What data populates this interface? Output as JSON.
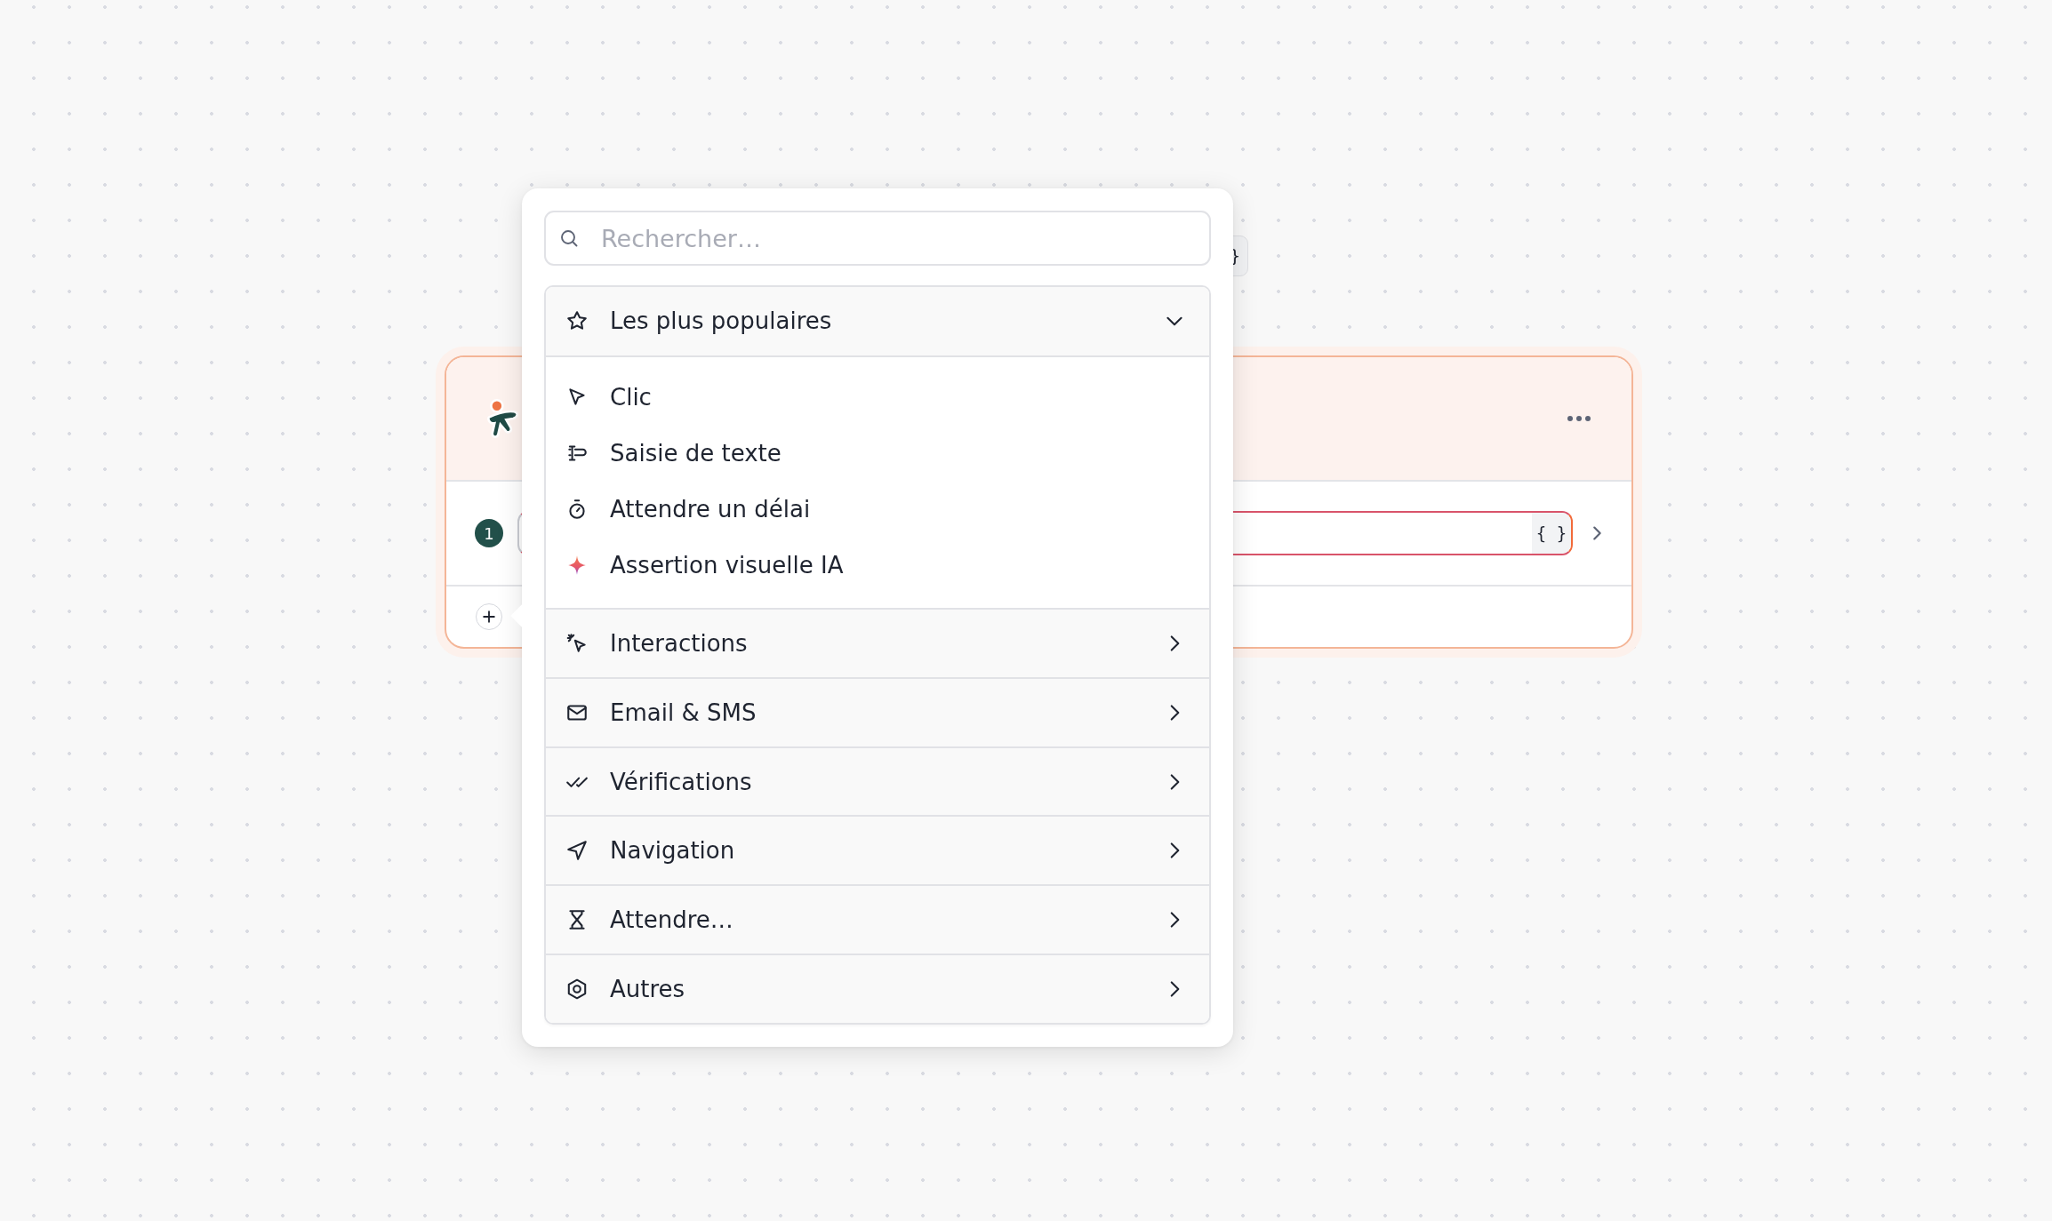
{
  "canvas": {
    "variables_chip": "}",
    "step_card": {
      "steps": [
        {
          "number": "1",
          "braces_button": "{ }"
        }
      ]
    }
  },
  "menu": {
    "search": {
      "placeholder": "Rechercher…"
    },
    "popular": {
      "label": "Les plus populaires",
      "expanded": true,
      "items": [
        {
          "label": "Clic"
        },
        {
          "label": "Saisie de texte"
        },
        {
          "label": "Attendre un délai"
        },
        {
          "label": "Assertion visuelle IA"
        }
      ]
    },
    "categories": [
      {
        "label": "Interactions"
      },
      {
        "label": "Email & SMS"
      },
      {
        "label": "Vérifications"
      },
      {
        "label": "Navigation"
      },
      {
        "label": "Attendre…"
      },
      {
        "label": "Autres"
      }
    ]
  }
}
